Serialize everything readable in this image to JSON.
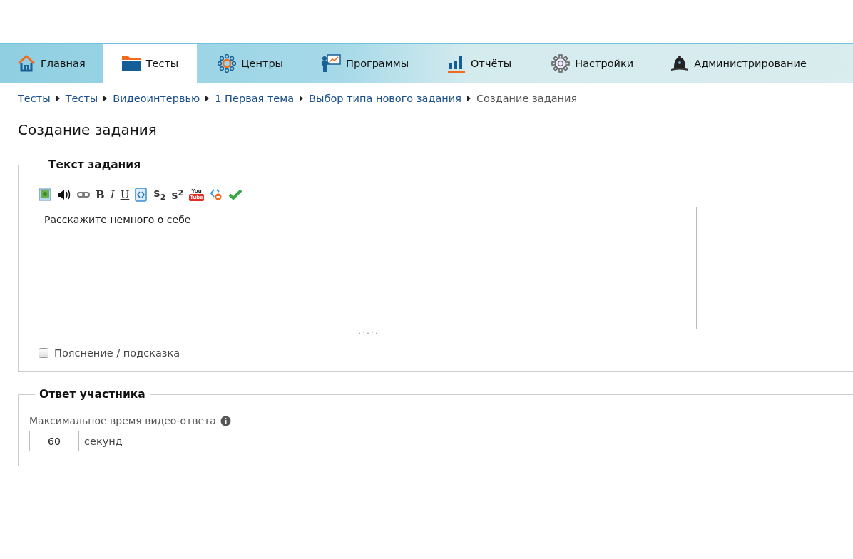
{
  "nav": {
    "tabs": [
      {
        "label": "Главная",
        "kind": "home",
        "selected": false
      },
      {
        "label": "Тесты",
        "kind": "folder",
        "selected": true
      },
      {
        "label": "Центры",
        "kind": "centers",
        "selected": false
      },
      {
        "label": "Программы",
        "kind": "presenter",
        "selected": false
      },
      {
        "label": "Отчёты",
        "kind": "chart",
        "selected": false
      },
      {
        "label": "Настройки",
        "kind": "gear",
        "selected": false
      },
      {
        "label": "Администрирование",
        "kind": "helmet",
        "selected": false
      }
    ]
  },
  "breadcrumbs": {
    "links": [
      "Тесты",
      "Тесты",
      "Видеоинтервью",
      "1 Первая тема",
      "Выбор типа нового задания"
    ],
    "current": "Создание задания"
  },
  "page_title": "Создание задания",
  "task_section": {
    "legend": "Текст задания",
    "toolbar": [
      {
        "kind": "image"
      },
      {
        "kind": "sound"
      },
      {
        "kind": "link"
      },
      {
        "kind": "bold",
        "label": "B"
      },
      {
        "kind": "italic",
        "label": "I"
      },
      {
        "kind": "underline",
        "label": "U"
      },
      {
        "kind": "code"
      },
      {
        "kind": "script",
        "label": "S$_{2}$"
      },
      {
        "kind": "script",
        "label": "S$^{2}$"
      },
      {
        "kind": "youtube",
        "lines": [
          "You",
          "Tube"
        ]
      },
      {
        "kind": "embed"
      },
      {
        "kind": "check"
      }
    ],
    "editor_text": "Расскажите немного о себе",
    "hint_checkbox": {
      "label": "Пояснение / подсказка",
      "checked": false
    }
  },
  "answer_section": {
    "legend": "Ответ участника",
    "field_label": "Максимальное время видео-ответа",
    "value": "60",
    "unit": "секунд"
  }
}
